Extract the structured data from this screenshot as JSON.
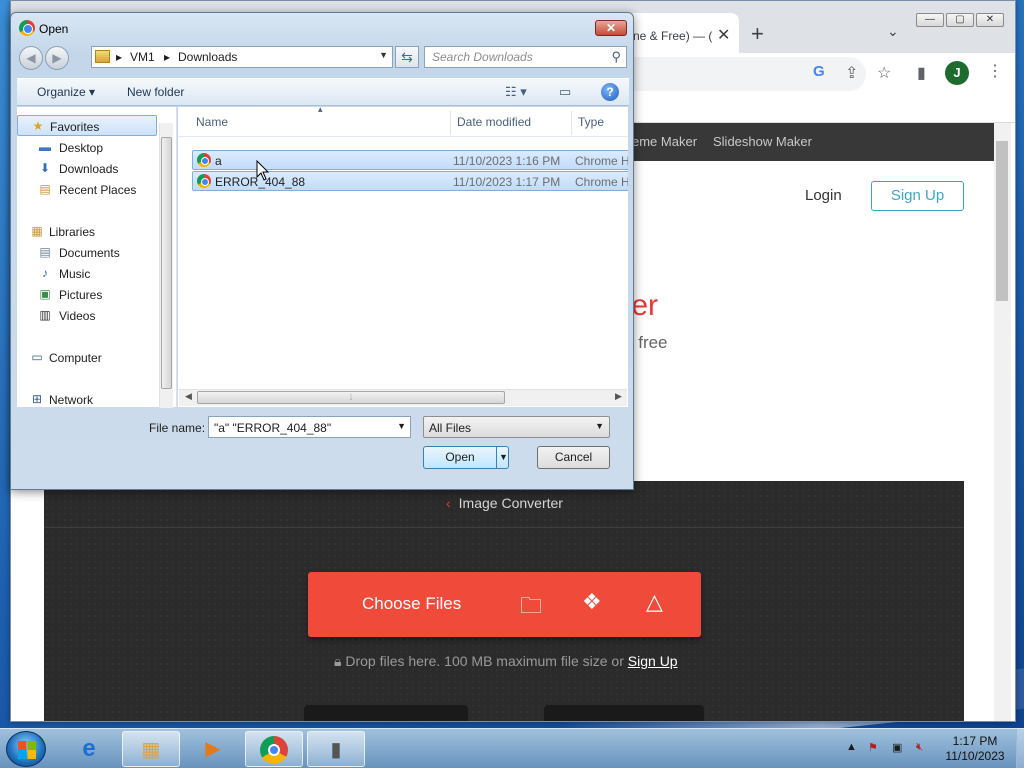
{
  "browser": {
    "tab_title": "ne & Free) — (",
    "tab_close": "✕",
    "new_tab": "+",
    "tab_menu": "⌄",
    "window_buttons": {
      "minimize": "—",
      "maximize": "▢",
      "close": "✕"
    },
    "avatar_letter": "J",
    "toolbar_icons": [
      "google-icon",
      "share-icon",
      "star-icon",
      "side-panel-icon",
      "avatar",
      "menu-icon"
    ]
  },
  "page": {
    "nav_items": [
      "eme Maker",
      "Slideshow Maker"
    ],
    "login": "Login",
    "signup": "Sign Up",
    "hero_fragment_a": "ter",
    "hero_fragment_b": "k free",
    "breadcrumb": "Image Converter",
    "choose_files": "Choose Files",
    "drop_text": "Drop files here. 100 MB maximum file size or",
    "drop_link": "Sign Up",
    "accent_color": "#f04a3b",
    "signup_color": "#3aa7c9"
  },
  "dialog": {
    "title": "Open",
    "address": {
      "root": "VM1",
      "folder": "Downloads"
    },
    "search_placeholder": "Search Downloads",
    "toolbar": {
      "organize": "Organize ▾",
      "new_folder": "New folder"
    },
    "sidebar": {
      "favorites": "Favorites",
      "desktop": "Desktop",
      "downloads": "Downloads",
      "recent": "Recent Places",
      "libraries": "Libraries",
      "documents": "Documents",
      "music": "Music",
      "pictures": "Pictures",
      "videos": "Videos",
      "computer": "Computer",
      "network": "Network"
    },
    "columns": {
      "name": "Name",
      "date": "Date modified",
      "type": "Type"
    },
    "files": [
      {
        "name": "a",
        "date": "11/10/2023 1:16 PM",
        "type": "Chrome H"
      },
      {
        "name": "ERROR_404_88",
        "date": "11/10/2023 1:17 PM",
        "type": "Chrome H"
      }
    ],
    "file_name_label": "File name:",
    "file_name_value": "\"a\" \"ERROR_404_88\"",
    "file_type_value": "All Files",
    "open_button": "Open",
    "cancel_button": "Cancel"
  },
  "taskbar": {
    "apps": [
      "internet-explorer",
      "windows-explorer",
      "media-player",
      "google-chrome",
      "file-dialog"
    ],
    "active_app": "google-chrome",
    "clock_time": "1:17 PM",
    "clock_date": "11/10/2023"
  }
}
